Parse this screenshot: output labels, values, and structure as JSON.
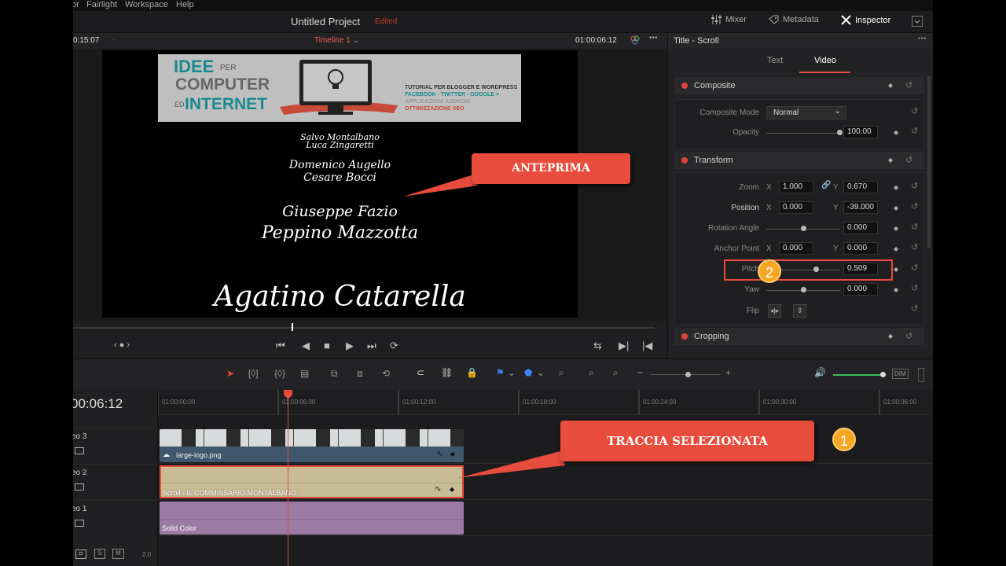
{
  "menu": [
    "or",
    "Fairlight",
    "Workspace",
    "Help"
  ],
  "header": {
    "project_title": "Untitled Project",
    "edited_label": "Edited",
    "mixer": "Mixer",
    "metadata": "Metadata",
    "inspector": "Inspector"
  },
  "viewer": {
    "timecode_left": "0:15:07",
    "timeline_name": "Timeline 1",
    "timecode_right": "01:00:06:12"
  },
  "frame": {
    "logo_idee": "IDEE",
    "logo_per": "PER",
    "logo_computer": "COMPUTER",
    "logo_ed": "ED",
    "logo_internet": "INTERNET",
    "logo_tag1": "TUTORIAL PER BLOGGER E WORDPRESS",
    "logo_tag2": "FACEBOOK - TWITTER - GOOGLE +",
    "logo_tag3": "APPLICAZIONI ANDROID",
    "logo_tag4": "OTTIMIZZAZIONE SEO",
    "credits": [
      "Salvo Montalbano",
      "Luca Zingaretti",
      "Domenico Augello",
      "Cesare Bocci",
      "Giuseppe Fazio",
      "Peppino Mazzotta",
      "Agatino Catarella"
    ]
  },
  "annotations": {
    "preview": "ANTEPRIMA",
    "selected_track": "TRACCIA SELEZIONATA",
    "badge1": "1",
    "badge2": "2"
  },
  "inspector": {
    "title": "Title - Scroll",
    "tab_text": "Text",
    "tab_video": "Video",
    "composite": {
      "label": "Composite",
      "mode_label": "Composite Mode",
      "mode_value": "Normal",
      "opacity_label": "Opacity",
      "opacity_value": "100.00"
    },
    "transform": {
      "label": "Transform",
      "zoom_label": "Zoom",
      "zoom_x": "1.000",
      "zoom_y": "0.670",
      "position_label": "Position",
      "pos_x": "0.000",
      "pos_y": "-39.000",
      "rotation_label": "Rotation Angle",
      "rotation_value": "0.000",
      "anchor_label": "Anchor Point",
      "anchor_x": "0.000",
      "anchor_y": "0.000",
      "pitch_label": "Pitch",
      "pitch_value": "0.509",
      "yaw_label": "Yaw",
      "yaw_value": "0.000",
      "flip_label": "Flip",
      "x": "X",
      "y": "Y"
    },
    "cropping": {
      "label": "Cropping"
    }
  },
  "timeline": {
    "timecode": "00:06:12",
    "ruler": [
      "01:00:00:00",
      "01:00:06:00",
      "01:00:12:00",
      "01:00:18:00",
      "01:00:24:00",
      "01:00:30:00",
      "01:00:36:00"
    ],
    "tracks": [
      {
        "name": "eo 3"
      },
      {
        "name": "eo 2"
      },
      {
        "name": "eo 1"
      }
    ],
    "clips": {
      "logo": "large-logo.png",
      "scroll": "Scroll - IL COMMISSARIO MONTALBANO...",
      "solid": "Solid Color"
    },
    "footer": {
      "s": "S",
      "m": "M",
      "num": "2.0"
    },
    "dim": "DIM"
  },
  "colors": {
    "accent_red": "#e74c3c",
    "badge": "#f5a623",
    "clip_logo": "#40586e",
    "clip_scroll": "#c9bb96",
    "clip_solid": "#9b7aa3"
  }
}
